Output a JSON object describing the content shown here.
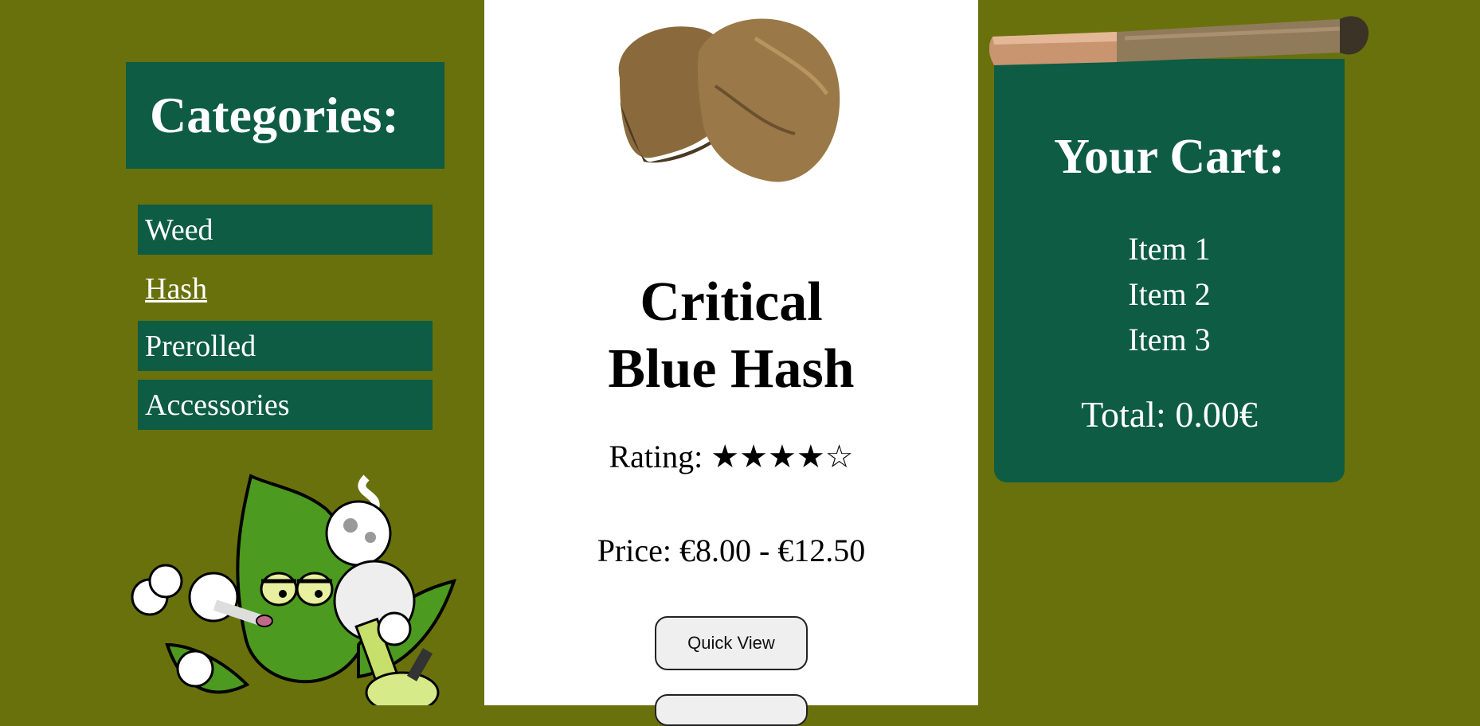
{
  "categories": {
    "title": "Categories:",
    "items": [
      {
        "label": "Weed"
      },
      {
        "label": "Hash"
      },
      {
        "label": "Prerolled"
      },
      {
        "label": "Accessories"
      }
    ]
  },
  "product": {
    "image": "hash-chunks-image",
    "name_line1": "Critical",
    "name_line2": "Blue Hash",
    "rating_label": "Rating:",
    "rating_stars": "★★★★☆",
    "rating_value": 4,
    "rating_max": 5,
    "price": "Price: €8.00 - €12.50",
    "quick_view_label": "Quick View"
  },
  "cart": {
    "title": "Your Cart:",
    "items": [
      "Item 1",
      "Item 2",
      "Item 3"
    ],
    "total": "Total: 0.00€"
  },
  "colors": {
    "page_bg": "#69710c",
    "panel_green": "#0d5c43",
    "center_bg": "#ffffff"
  }
}
